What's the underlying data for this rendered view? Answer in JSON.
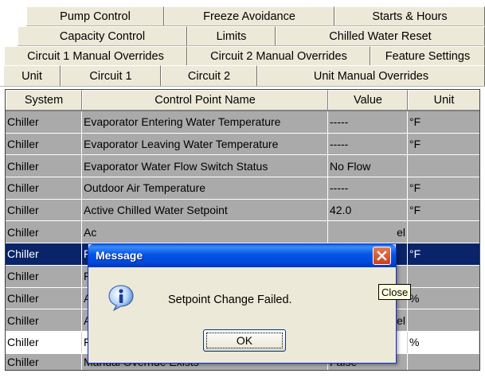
{
  "tabs": {
    "row1": [
      "Pump Control",
      "Freeze Avoidance",
      "Starts & Hours"
    ],
    "row2": [
      "Capacity Control",
      "Limits",
      "Chilled Water Reset"
    ],
    "row3": [
      "Circuit 1 Manual Overrides",
      "Circuit 2 Manual Overrides",
      "Feature Settings"
    ],
    "row4": [
      "Unit",
      "Circuit 1",
      "Circuit 2",
      "Unit Manual Overrides"
    ],
    "selected": "Unit"
  },
  "table": {
    "headers": [
      "System",
      "Control Point Name",
      "Value",
      "Unit"
    ],
    "rows": [
      {
        "system": "Chiller",
        "name": "Evaporator Entering Water Temperature",
        "value": "-----",
        "unit": "°F"
      },
      {
        "system": "Chiller",
        "name": "Evaporator Leaving Water Temperature",
        "value": "-----",
        "unit": "°F"
      },
      {
        "system": "Chiller",
        "name": "Evaporator Water Flow Switch Status",
        "value": "No Flow",
        "unit": ""
      },
      {
        "system": "Chiller",
        "name": "Outdoor Air Temperature",
        "value": "-----",
        "unit": "°F"
      },
      {
        "system": "Chiller",
        "name": "Active Chilled Water Setpoint",
        "value": "42.0",
        "unit": "°F"
      },
      {
        "system": "Chiller",
        "name": "Ac",
        "value": "el",
        "unit": ""
      },
      {
        "system": "Chiller",
        "name": "Fr",
        "value": "",
        "unit": "°F"
      },
      {
        "system": "Chiller",
        "name": "Fi",
        "value": "",
        "unit": ""
      },
      {
        "system": "Chiller",
        "name": "Ac",
        "value": "",
        "unit": "%"
      },
      {
        "system": "Chiller",
        "name": "Ac",
        "value": "el",
        "unit": ""
      },
      {
        "system": "Chiller",
        "name": "Fr",
        "value": "",
        "unit": "%"
      },
      {
        "system": "Chiller",
        "name": "Manual Override Exists",
        "value": "False",
        "unit": ""
      }
    ]
  },
  "dialog": {
    "title": "Message",
    "message": "Setpoint Change Failed.",
    "ok_label": "OK",
    "icon": "info-icon"
  },
  "tooltip": {
    "text": "Close"
  },
  "colors": {
    "tab_bg": "#ece9d8",
    "row_bg": "#aaaaaa",
    "selected_row": "#0a246a",
    "titlebar": "#0054e3",
    "close_button": "#e05a2e"
  }
}
